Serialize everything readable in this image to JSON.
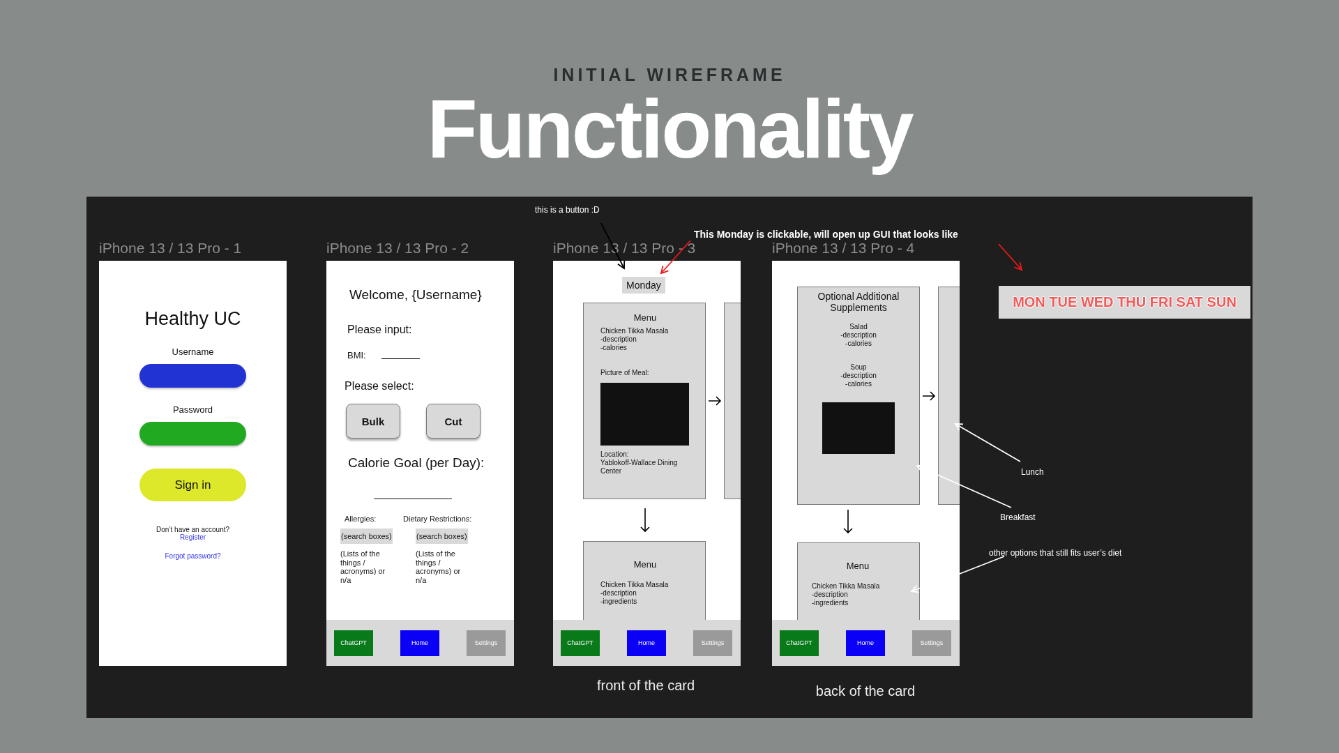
{
  "header": {
    "eyebrow": "INITIAL WIREFRAME",
    "title": "Functionality"
  },
  "frames": [
    {
      "kind": "login",
      "label": "iPhone 13 / 13 Pro - 1",
      "title": "Healthy UC",
      "fields": [
        {
          "label": "Username",
          "color": "#2233d4"
        },
        {
          "label": "Password",
          "color": "#22a922"
        }
      ],
      "button": "Sign in",
      "prompt": "Don’t have an account?",
      "register": "Register",
      "forgot": "Forgot password?"
    },
    {
      "kind": "preferences",
      "label": "iPhone 13 / 13 Pro - 2",
      "title": "Welcome, {Username}",
      "input_heading": "Please input:",
      "bmi_label": "BMI:",
      "select_heading": "Please select:",
      "options": [
        "Bulk",
        "Cut"
      ],
      "goal_heading": "Calorie Goal (per Day):",
      "columns": [
        {
          "heading": "Allergies:",
          "search": "(search boxes)",
          "note": "(Lists of the things / acronyms) or n/a"
        },
        {
          "heading": "Dietary Restrictions:",
          "search": "(search boxes)",
          "note": "(Lists of the things / acronyms) or n/a"
        }
      ],
      "nav": [
        {
          "label": "ChatGPT",
          "color": "#087a1a"
        },
        {
          "label": "Home",
          "color": "#0a00f5"
        },
        {
          "label": "Settings",
          "color": "#9a9a9a"
        }
      ]
    },
    {
      "kind": "menu_front",
      "label": "iPhone 13 / 13 Pro - 3",
      "day": "Monday",
      "card": {
        "title": "Menu",
        "lines": [
          "Chicken Tikka Masala",
          "-description",
          "-calories"
        ],
        "picture_label": "Picture of Meal:",
        "location": [
          "Location:",
          "Yablokoff-Wallace Dining",
          "Center"
        ]
      },
      "next_card": {
        "title": "Menu",
        "lines": [
          "Chicken Tikka Masala",
          "-description",
          "-ingredients"
        ]
      },
      "nav": [
        {
          "label": "ChatGPT",
          "color": "#087a1a"
        },
        {
          "label": "Home",
          "color": "#0a00f5"
        },
        {
          "label": "Settings",
          "color": "#9a9a9a"
        }
      ]
    },
    {
      "kind": "menu_back",
      "label": "iPhone 13 / 13 Pro - 4",
      "card": {
        "title": "Optional Additional Supplements",
        "items": [
          [
            "Salad",
            "-description",
            "-calories"
          ],
          [
            "Soup",
            "-description",
            "-calories"
          ]
        ]
      },
      "next_card": {
        "title": "Menu",
        "lines": [
          "Chicken Tikka Masala",
          "-description",
          "-ingredients"
        ]
      },
      "nav": [
        {
          "label": "ChatGPT",
          "color": "#087a1a"
        },
        {
          "label": "Home",
          "color": "#0a00f5"
        },
        {
          "label": "Settings",
          "color": "#9a9a9a"
        }
      ]
    }
  ],
  "notes": [
    "this is a button :D",
    "This Monday is clickable, will open up GUI that looks like",
    "Lunch",
    "Breakfast",
    "other options that still fits user’s diet"
  ],
  "day_strip": "MON TUE WED THU FRI SAT SUN",
  "captions": [
    "front of the card",
    "back of the card"
  ]
}
